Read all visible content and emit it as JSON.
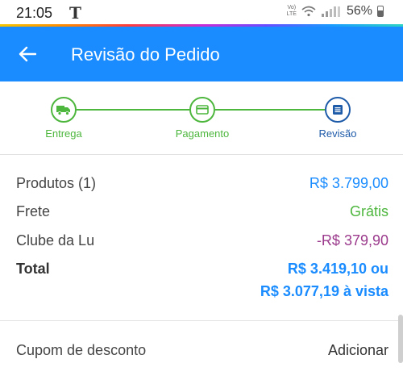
{
  "status": {
    "time": "21:05",
    "carrier_glyph": "T",
    "volte_top": "Vo)",
    "volte_bottom": "LTE",
    "battery": "56%"
  },
  "appbar": {
    "title": "Revisão do Pedido",
    "background": "#1a8cff"
  },
  "steps": [
    {
      "label": "Entrega",
      "icon": "truck-icon",
      "state": "done"
    },
    {
      "label": "Pagamento",
      "icon": "card-icon",
      "state": "done"
    },
    {
      "label": "Revisão",
      "icon": "list-icon",
      "state": "current"
    }
  ],
  "summary": {
    "products_label": "Produtos (1)",
    "products_value": "R$ 3.799,00",
    "shipping_label": "Frete",
    "shipping_value": "Grátis",
    "club_label": "Clube da Lu",
    "club_value": "-R$ 379,90",
    "total_label": "Total",
    "total_value_line1": "R$ 3.419,10 ou",
    "total_value_line2": "R$ 3.077,19 à vista"
  },
  "coupon": {
    "label": "Cupom de desconto",
    "action": "Adicionar"
  },
  "colors": {
    "blue": "#1a8cff",
    "green": "#4db63d",
    "purple": "#9b3a8c",
    "step_current": "#1d5aa8"
  }
}
